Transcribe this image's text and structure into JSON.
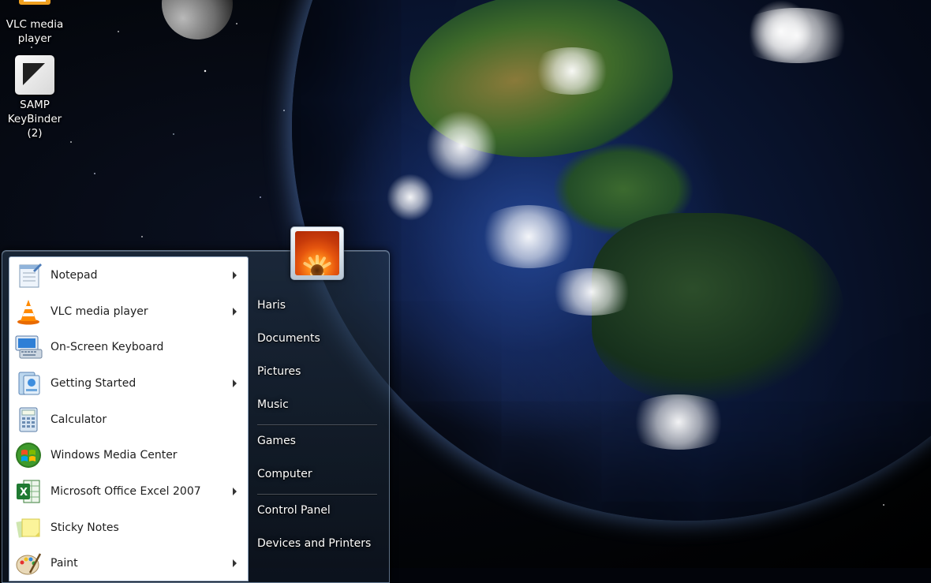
{
  "desktop": {
    "icons": [
      {
        "label_line1": "VLC media",
        "label_line2": "player",
        "icon": "vlc-cone-icon"
      },
      {
        "label_line1": "SAMP",
        "label_line2": "KeyBinder (2)",
        "icon": "samp-keybinder-icon"
      }
    ]
  },
  "start_menu": {
    "programs": [
      {
        "label": "Notepad",
        "icon": "notepad-icon",
        "has_submenu": true
      },
      {
        "label": "VLC media player",
        "icon": "vlc-cone-icon",
        "has_submenu": true
      },
      {
        "label": "On-Screen Keyboard",
        "icon": "keyboard-icon",
        "has_submenu": false
      },
      {
        "label": "Getting Started",
        "icon": "getting-started-icon",
        "has_submenu": true
      },
      {
        "label": "Calculator",
        "icon": "calculator-icon",
        "has_submenu": false
      },
      {
        "label": "Windows Media Center",
        "icon": "windows-orb-icon",
        "has_submenu": false
      },
      {
        "label": "Microsoft Office Excel 2007",
        "icon": "excel-icon",
        "has_submenu": true
      },
      {
        "label": "Sticky Notes",
        "icon": "sticky-notes-icon",
        "has_submenu": false
      },
      {
        "label": "Paint",
        "icon": "paint-palette-icon",
        "has_submenu": true
      }
    ],
    "user_picture": "flower-user-icon",
    "links": [
      {
        "label": "Haris"
      },
      {
        "label": "Documents"
      },
      {
        "label": "Pictures"
      },
      {
        "label": "Music"
      },
      {
        "label": "Games"
      },
      {
        "label": "Computer"
      },
      {
        "label": "Control Panel"
      },
      {
        "label": "Devices and Printers"
      }
    ]
  },
  "colors": {
    "programs_bg": "#ffffff",
    "menu_frame": "#2a3c50",
    "link_text": "#ffffff"
  }
}
